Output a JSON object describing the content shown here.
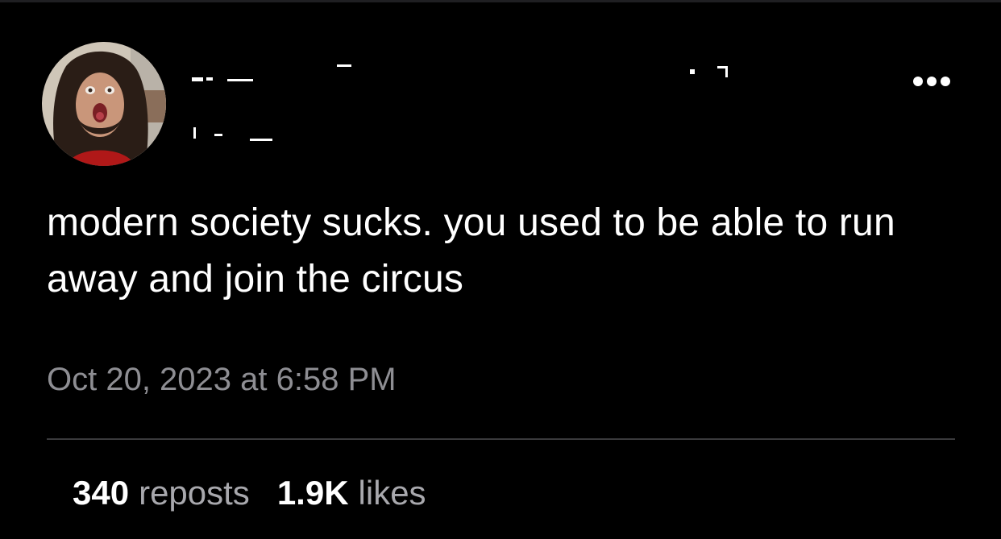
{
  "post": {
    "text": "modern society sucks. you used to be able to run away and join the circus",
    "timestamp": "Oct 20, 2023 at 6:58 PM",
    "menu_icon": "more-horizontal-icon"
  },
  "stats": {
    "reposts_count": "340",
    "reposts_label": "reposts",
    "likes_count": "1.9K",
    "likes_label": "likes"
  },
  "colors": {
    "background": "#000000",
    "text": "#ffffff",
    "secondary_text": "#8e8e93",
    "divider": "#3a3a3c"
  }
}
